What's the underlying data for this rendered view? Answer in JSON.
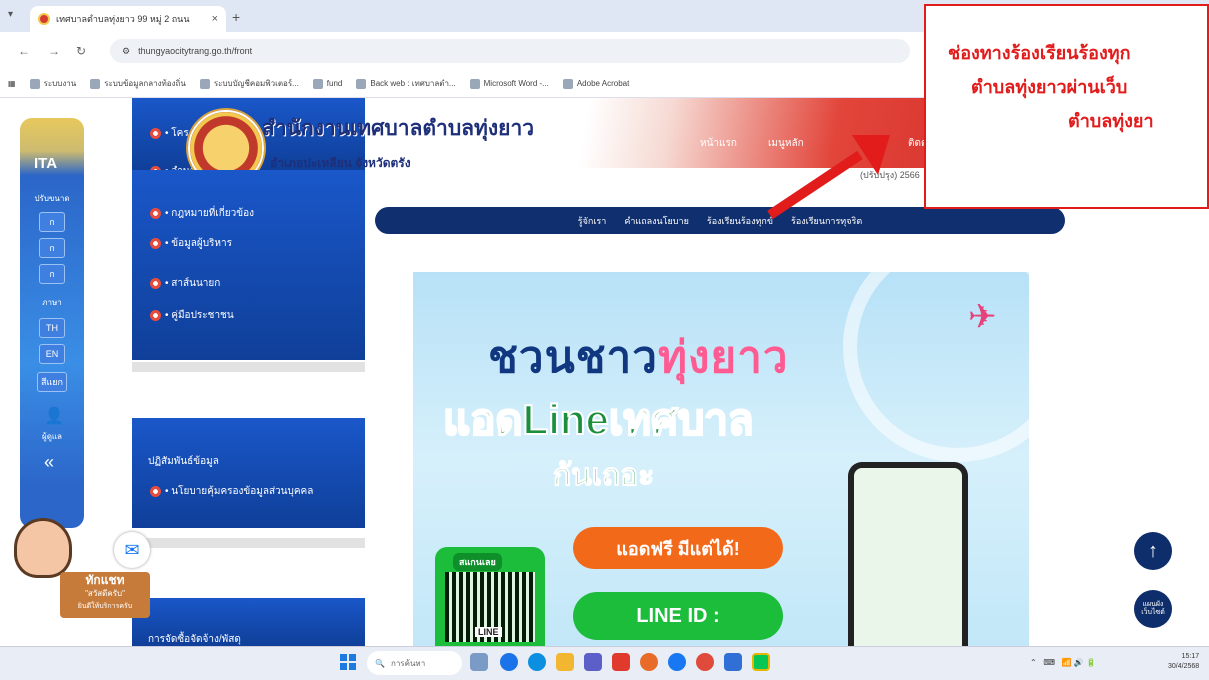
{
  "browser": {
    "tab_title": "เทศบาลตำบลทุ่งยาว 99 หมู่ 2 ถนน",
    "tab_close": "×",
    "new_tab": "+",
    "url": "thungyaocitytrang.go.th/front",
    "bookmarks": [
      "ระบบงาน",
      "ระบบข้อมูลกลางท้องถิ่น",
      "ระบบบัญชีคอมพิวเตอร์...",
      "fund",
      "Back web : เทศบาลตำ...",
      "Microsoft Word -...",
      "Adobe Acrobat"
    ]
  },
  "site": {
    "title": "สำนักงานเทศบาลตำบลทุ่งยาว",
    "subtitle": "อำเภอปะเหลียน จังหวัดตรัง",
    "top_menu": [
      "หน้าแรก",
      "เมนูหลัก",
      "ติดต่อ"
    ],
    "date": "(ปรับปรุง) 2566"
  },
  "itas": {
    "label": "ITA",
    "sublabel": "ปรับขนาด",
    "buttons": [
      "ก",
      "ก",
      "ก"
    ],
    "lang_label": "ภาษา",
    "lang_buttons": [
      "TH",
      "EN"
    ],
    "access_btn": "สีแยก",
    "user_label": "ผู้ดูแล",
    "collapse": "«"
  },
  "left_menu": {
    "top_items": [
      "• โครงสร้าง",
      "• อำนาจหน้าที่"
    ],
    "items": [
      "• กฎหมายที่เกี่ยวข้อง",
      "• ข้อมูลผู้บริหาร",
      "• สาส์นนายก",
      "• คู่มือประชาชน"
    ],
    "section2_title": "ปฏิสัมพันธ์ข้อมูล",
    "section2_items": [
      "• นโยบายคุ้มครองข้อมูลส่วนบุคคล"
    ],
    "section3_title": "การจัดซื้อจัดจ้าง/พัสดุ"
  },
  "navbar": [
    "รู้จักเรา",
    "คำแถลงนโยบาย",
    "ร้องเรียนร้องทุกข์",
    "ร้องเรียนการทุจริต"
  ],
  "banner": {
    "line1_a": "ชวนชาว",
    "line1_b": "ทุ่งยาว",
    "line2": "แอดLineเทศบาล",
    "line3": "กันเถอะ",
    "add_free": "แอดฟรี มีแต่ได้!",
    "line_id": "LINE ID :",
    "scan_label": "สแกนเลย",
    "qr_label": "LINE"
  },
  "callout": {
    "line1": "ช่องทางร้องเรียนร้องทุก",
    "line2": "ตำบลทุ่งยาวผ่านเว็บ",
    "line3": "ตำบลทุ่งยา"
  },
  "mascot": {
    "line1": "ทักแชท",
    "line2": "\"สวัสดีครับ\"",
    "line3": "ยินดีให้บริการครับ"
  },
  "float": {
    "up": "↑",
    "map_line1": "แผนผัง",
    "map_line2": "เว็บไซต์"
  },
  "taskbar": {
    "search_placeholder": "การค้นหา",
    "clock_time": "15:17",
    "clock_date": "30/4/2568"
  }
}
